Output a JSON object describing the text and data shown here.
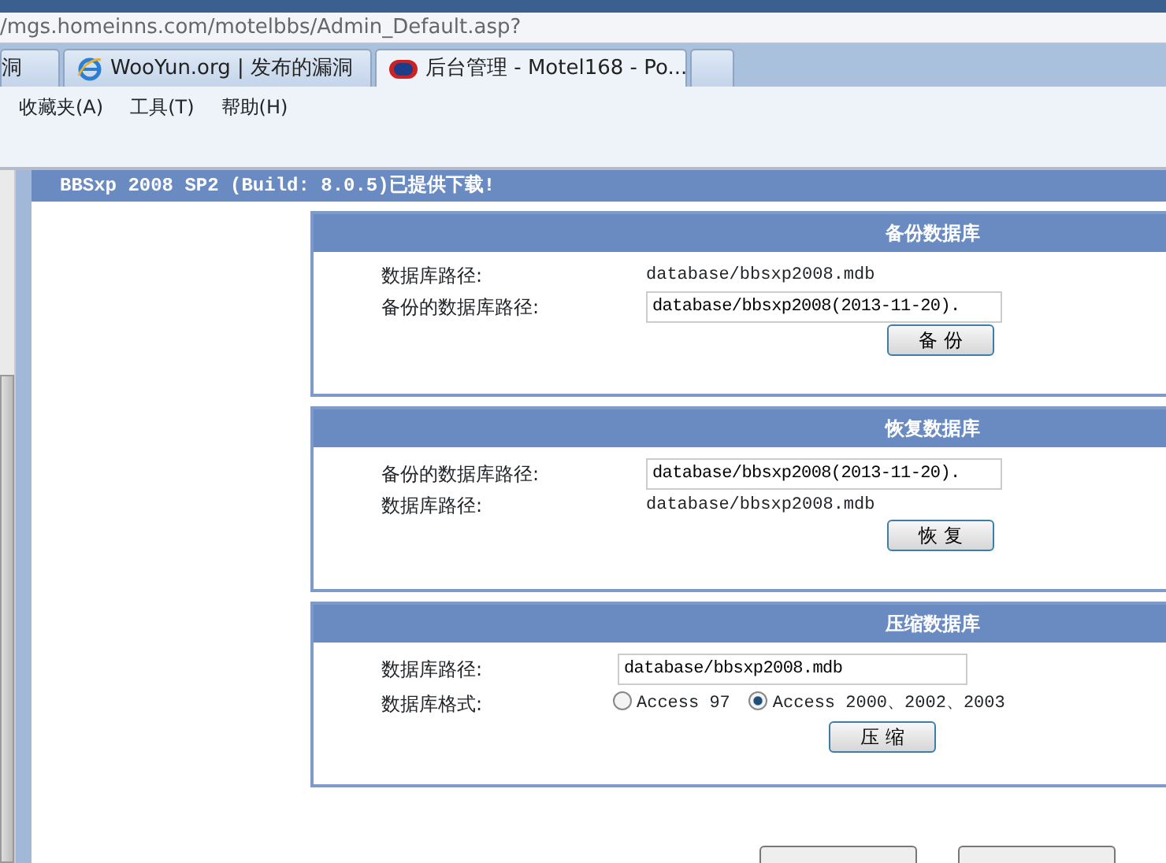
{
  "browser": {
    "address": "/mgs.homeinns.com/motelbbs/Admin_Default.asp?",
    "tabs": [
      {
        "label": "洞",
        "selected": false
      },
      {
        "label": "WooYun.org | 发布的漏洞",
        "selected": false
      },
      {
        "label": "后台管理 - Motel168 - Po...",
        "selected": true
      }
    ],
    "menu": [
      "收藏夹(A)",
      "工具(T)",
      "帮助(H)"
    ]
  },
  "banner": "BBSxp 2008 SP2 (Build: 8.0.5)已提供下载!",
  "sections": [
    {
      "title": "备份数据库",
      "rows": [
        {
          "kind": "text",
          "label": "数据库路径:",
          "value": "database/bbsxp2008.mdb"
        },
        {
          "kind": "input",
          "label": "备份的数据库路径:",
          "value": "database/bbsxp2008(2013-11-20)."
        }
      ],
      "button": "备 份"
    },
    {
      "title": "恢复数据库",
      "rows": [
        {
          "kind": "input",
          "label": "备份的数据库路径:",
          "value": "database/bbsxp2008(2013-11-20)."
        },
        {
          "kind": "text",
          "label": "数据库路径:",
          "value": "database/bbsxp2008.mdb"
        }
      ],
      "button": "恢 复"
    },
    {
      "title": "压缩数据库",
      "rows": [
        {
          "kind": "wideinput",
          "label": "数据库路径:",
          "value": "database/bbsxp2008.mdb"
        },
        {
          "kind": "radio",
          "label": "数据库格式:",
          "options": [
            {
              "label": "Access 97",
              "selected": false
            },
            {
              "label": "Access 2000、2002、2003",
              "selected": true
            }
          ]
        }
      ],
      "button": "压 缩"
    }
  ]
}
